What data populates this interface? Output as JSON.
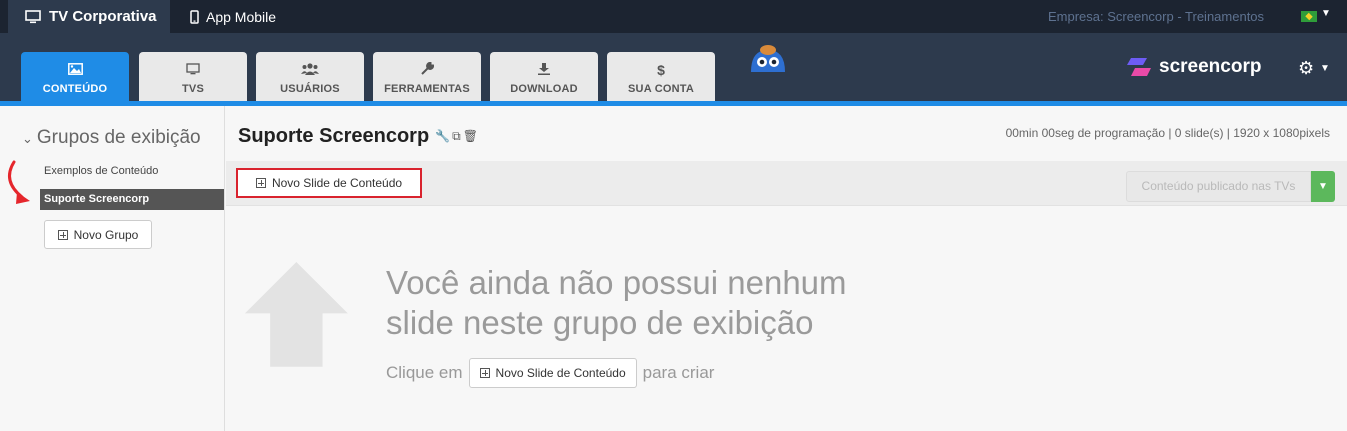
{
  "topbar": {
    "tab_tv": "TV Corporativa",
    "tab_mobile": "App Mobile",
    "empresa": "Empresa: Screencorp - Treinamentos"
  },
  "nav": {
    "tabs": [
      {
        "label": "CONTEÚDO",
        "icon": "image-icon"
      },
      {
        "label": "TVS",
        "icon": "monitor-icon"
      },
      {
        "label": "USUÁRIOS",
        "icon": "users-icon"
      },
      {
        "label": "FERRAMENTAS",
        "icon": "wrench-icon"
      },
      {
        "label": "DOWNLOAD",
        "icon": "download-icon"
      },
      {
        "label": "SUA CONTA",
        "icon": "dollar-icon"
      }
    ],
    "brand": "screencorp"
  },
  "sidebar": {
    "title": "Grupos de exibição",
    "items": [
      "Exemplos de Conteúdo",
      "Suporte Screencorp"
    ],
    "new_group": "Novo Grupo"
  },
  "content": {
    "title": "Suporte Screencorp",
    "info": "00min 00seg de programação | 0 slide(s) | 1920 x 1080pixels",
    "new_slide": "Novo Slide de Conteúdo",
    "published": "Conteúdo publicado nas TVs",
    "empty_line1": "Você ainda não possui nenhum",
    "empty_line2": "slide neste grupo de exibição",
    "hint_prefix": "Clique em",
    "hint_button": "Novo Slide de Conteúdo",
    "hint_suffix": "para criar"
  },
  "colors": {
    "accent": "#1f8ce6",
    "topbar": "#1c2431",
    "navbar": "#2d3a4d",
    "highlight": "#d9232e",
    "success": "#5cb85c"
  }
}
